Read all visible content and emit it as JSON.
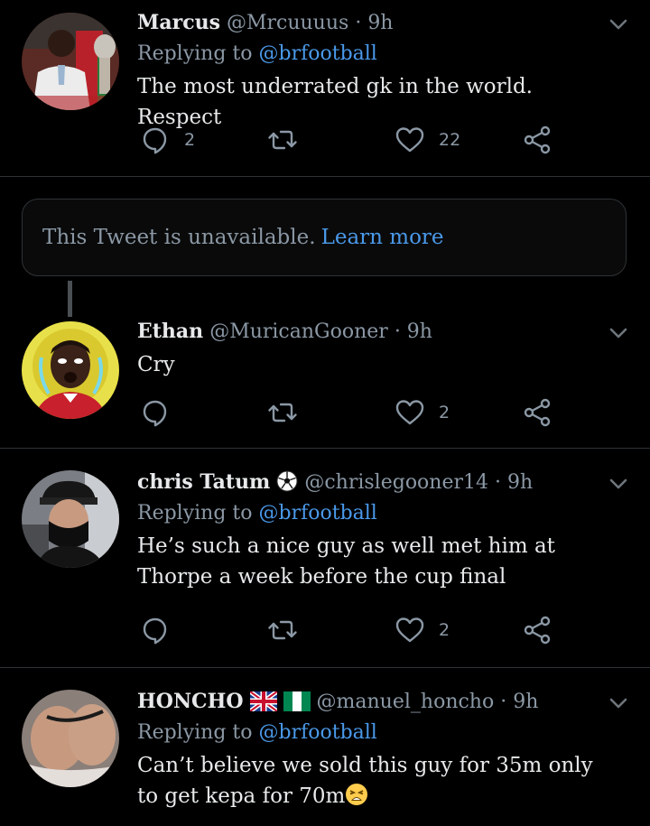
{
  "colors": {
    "background": "#000000",
    "accent": "#4a99e9",
    "muted": "#8b98a5",
    "text": "#e7e9ea",
    "divider": "#2f3336"
  },
  "tweets": [
    {
      "name": "Marcus",
      "handle": "@Mrcuuuus",
      "time": "· 9h",
      "replying_prefix": "Replying to",
      "replying_to": "@brfootball",
      "text": "The most underrated gk in the world. Respect",
      "replies": "2",
      "likes": "22"
    },
    {
      "name": "Ethan",
      "handle": "@MuricanGooner",
      "time": "· 9h",
      "text": "Cry",
      "replies": "",
      "likes": "2"
    },
    {
      "name": "chris Tatum",
      "name_emoji": "⚽",
      "handle": "@chrislegooner14",
      "time": "· 9h",
      "replying_prefix": "Replying to",
      "replying_to": "@brfootball",
      "text": "He’s such a nice guy as well met him at Thorpe a week before the cup final",
      "replies": "",
      "likes": "2"
    },
    {
      "name": "HONCHO",
      "name_emoji": "🇬🇧🇳🇬",
      "handle": "@manuel_honcho",
      "time": "· 9h",
      "replying_prefix": "Replying to",
      "replying_to": "@brfootball",
      "text": "Can’t believe we sold this guy for 35m only to get kepa for 70m",
      "text_emoji": "😫"
    }
  ],
  "unavailable": {
    "text": "This Tweet is unavailable.",
    "link": "Learn more"
  },
  "icons": [
    "reply-icon",
    "retweet-icon",
    "like-icon",
    "share-icon",
    "chevron-down-icon",
    "soccer-ball-icon",
    "uk-flag-icon",
    "nigeria-flag-icon",
    "tired-face-emoji"
  ]
}
